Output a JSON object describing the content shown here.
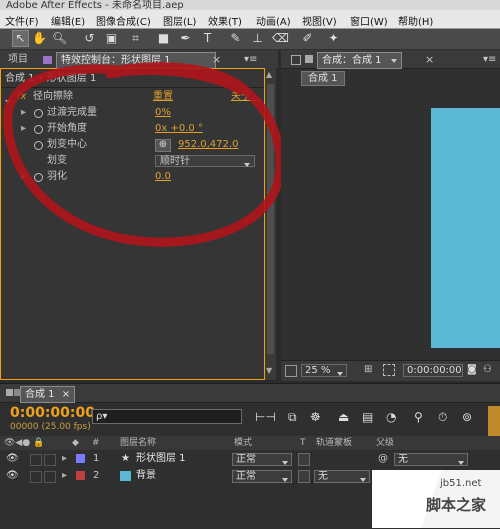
{
  "window": {
    "title": "Adobe After Effects - 未命名项目.aep"
  },
  "menu": [
    "文件(F)",
    "编辑(E)",
    "图像合成(C)",
    "图层(L)",
    "效果(T)",
    "动画(A)",
    "视图(V)",
    "窗口(W)",
    "帮助(H)"
  ],
  "left_tabs": {
    "project": "项目",
    "effects": "特效控制台：形状图层 1",
    "close": "×",
    "menu": "▾≡"
  },
  "effects": {
    "breadcrumb": "合成 1 • 形状图层 1",
    "fx": "fx",
    "effect_name": "径向擦除",
    "reset": "重置",
    "about": "关于...",
    "props": [
      {
        "label": "过渡完成量",
        "value": "0%"
      },
      {
        "label": "开始角度",
        "value": "0x +0.0 °"
      },
      {
        "label": "划变中心",
        "value": "952.0,472.0"
      },
      {
        "label": "划变",
        "value": "顺时针"
      },
      {
        "label": "羽化",
        "value": "0.0"
      }
    ]
  },
  "comp": {
    "tab": "合成：合成 1",
    "tab_menu": "▾≡",
    "subtab": "合成 1",
    "zoom": "25 %",
    "timecode": "0:00:00:00",
    "preview_color": "#5bb9d6"
  },
  "timeline": {
    "tab": "合成 1",
    "timecode": "0:00:00:00",
    "frames": "00000 (25.00 fps)",
    "search_placeholder": "ρ▾",
    "columns": {
      "num": "#",
      "name": "图层名称",
      "mode": "模式",
      "t": "T",
      "trkmat": "轨道蒙板",
      "parent": "父级"
    },
    "layers": [
      {
        "num": "1",
        "name": "形状图层 1",
        "color": "#7b7bff",
        "mode": "正常",
        "trkmat": "",
        "parent": "无"
      },
      {
        "num": "2",
        "name": "背景",
        "color": "#c04040",
        "mode": "正常",
        "trkmat": "无",
        "parent": "无",
        "swatch": "#5bb9d6"
      }
    ]
  },
  "watermark": {
    "site": "jb51.net",
    "text": "脚本之家"
  },
  "annotation": {
    "color": "#b0141a"
  }
}
